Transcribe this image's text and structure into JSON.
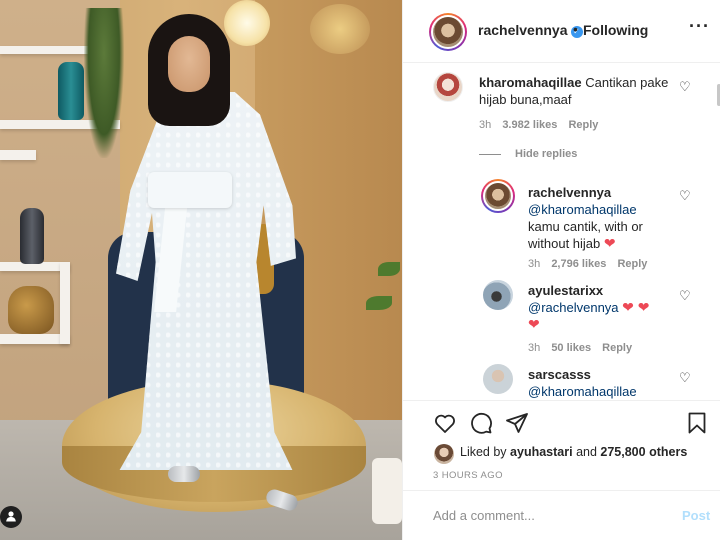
{
  "photo": {
    "alt_icon": "person-icon"
  },
  "header": {
    "username": "rachelvennya",
    "separator": "•",
    "follow_status": "Following",
    "more": "···"
  },
  "comments": [
    {
      "user": "kharomahaqillae",
      "text": "Cantikan pake hijab buna,maaf",
      "time": "3h",
      "likes": "3.982 likes",
      "reply": "Reply"
    }
  ],
  "hide_replies": "Hide replies",
  "replies": [
    {
      "user": "rachelvennya",
      "mention": "@kharomahaqillae",
      "text": "kamu cantik, with or without hijab",
      "emoji": "❤",
      "time": "3h",
      "likes": "2,796 likes",
      "reply": "Reply"
    },
    {
      "user": "ayulestarixx",
      "mention": "@rachelvennya",
      "emoji": "❤ ❤",
      "emoji2": "❤",
      "time": "3h",
      "likes": "50 likes",
      "reply": "Reply"
    },
    {
      "user": "sarscasss",
      "mention": "@kharomahaqillae"
    }
  ],
  "likes_summary": {
    "prefix": "Liked by",
    "user": "ayuhastari",
    "middle": "and",
    "count": "275,800 others"
  },
  "timestamp": "3 HOURS AGO",
  "comment_box": {
    "placeholder": "Add a comment...",
    "post_label": "Post"
  },
  "colors": {
    "link": "#00376b",
    "verified": "#3897f0",
    "heart": "#ed4956",
    "post_disabled": "#b2dffc",
    "meta": "#8e8e8e"
  }
}
